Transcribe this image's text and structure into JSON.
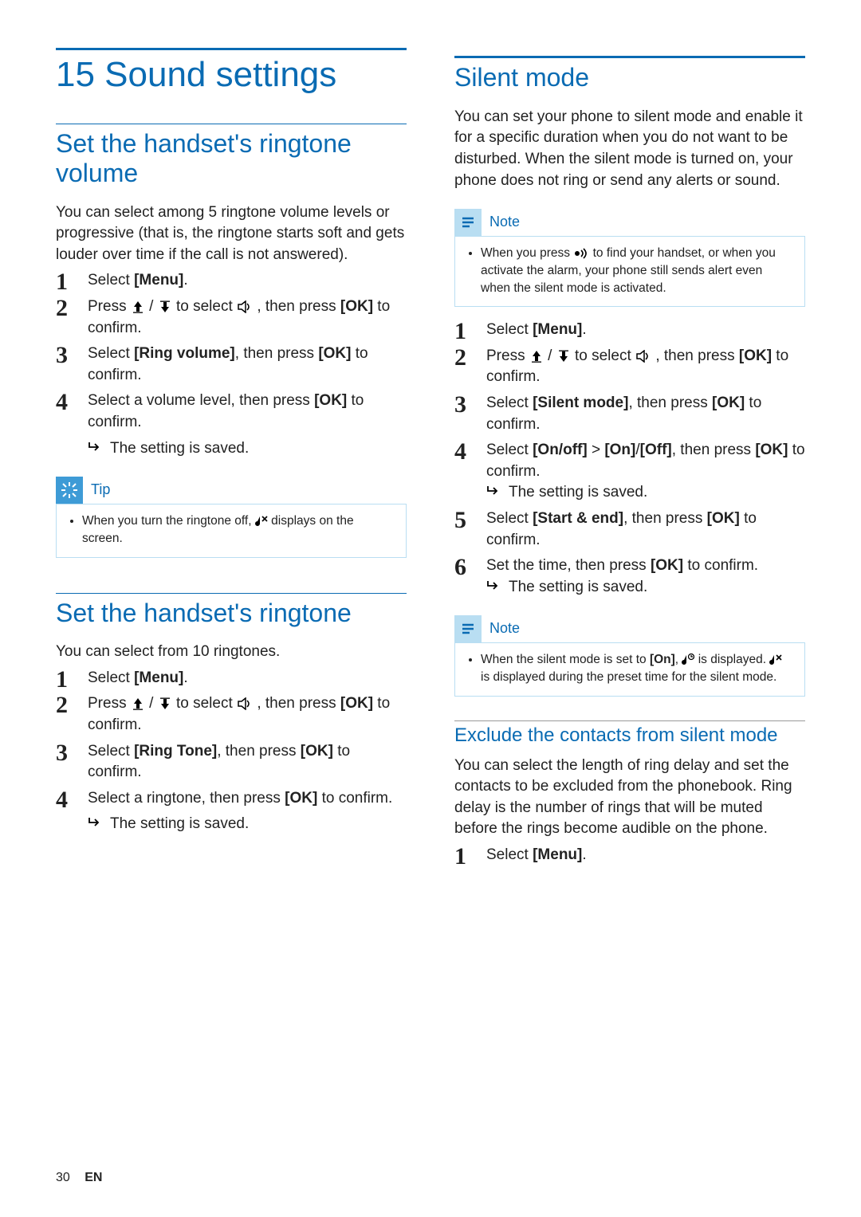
{
  "chapter": "15 Sound settings",
  "footer": {
    "pageNo": "30",
    "lang": "EN"
  },
  "icons": {
    "up": "up-icon",
    "down": "down-icon",
    "sound": "sound-icon",
    "pager": "pager-icon",
    "muteNote": "mute-note-icon",
    "clockNote": "clock-note-icon"
  },
  "callout_labels": {
    "tip": "Tip",
    "note": "Note"
  },
  "left": {
    "sec1": {
      "title": "Set the handset's ringtone volume",
      "intro": "You can select among 5 ringtone volume levels or progressive (that is, the ringtone starts soft and gets louder over time if the call is not answered).",
      "s1a": "Select ",
      "s1b": "[Menu]",
      "s1c": ".",
      "s2a": "Press ",
      "s2b": " / ",
      "s2c": " to select ",
      "s2d": ", then press ",
      "s2e": "[OK]",
      "s2f": " to confirm.",
      "s3a": "Select ",
      "s3b": "[Ring volume]",
      "s3c": ", then press ",
      "s3d": "[OK]",
      "s3e": " to confirm.",
      "s4a": "Select a volume level, then press ",
      "s4b": "[OK]",
      "s4c": " to confirm.",
      "result": "The setting is saved.",
      "tip_a": "When you turn the ringtone off, ",
      "tip_b": " displays on the screen."
    },
    "sec2": {
      "title": "Set the handset's ringtone",
      "intro": "You can select from 10 ringtones.",
      "s1a": "Select ",
      "s1b": "[Menu]",
      "s1c": ".",
      "s2a": "Press ",
      "s2b": " / ",
      "s2c": " to select ",
      "s2d": ", then press ",
      "s2e": "[OK]",
      "s2f": " to confirm.",
      "s3a": "Select ",
      "s3b": "[Ring Tone]",
      "s3c": ", then press ",
      "s3d": "[OK]",
      "s3e": " to confirm.",
      "s4a": "Select a ringtone, then press ",
      "s4b": "[OK]",
      "s4c": " to confirm.",
      "result": "The setting is saved."
    }
  },
  "right": {
    "sec1": {
      "title": "Silent mode",
      "intro": "You can set your phone to silent mode and enable it for a specific duration when you do not want to be disturbed. When the silent mode is turned on, your phone does not ring or send any alerts or sound.",
      "note1_a": "When you press ",
      "note1_b": " to find your handset, or when you activate the alarm, your phone still sends alert even when the silent mode is activated.",
      "s1a": "Select ",
      "s1b": "[Menu]",
      "s1c": ".",
      "s2a": "Press ",
      "s2b": " / ",
      "s2c": " to select ",
      "s2d": ", then press ",
      "s2e": "[OK]",
      "s2f": " to confirm.",
      "s3a": "Select ",
      "s3b": "[Silent mode]",
      "s3c": ", then press ",
      "s3d": "[OK]",
      "s3e": " to confirm.",
      "s4a": "Select ",
      "s4b": "[On/off]",
      "s4c": " > ",
      "s4d": "[On]",
      "s4e": "/",
      "s4f": "[Off]",
      "s4g": ", then press ",
      "s4h": "[OK]",
      "s4i": " to confirm.",
      "result1": "The setting is saved.",
      "s5a": "Select ",
      "s5b": "[Start & end]",
      "s5c": ", then press ",
      "s5d": "[OK]",
      "s5e": " to confirm.",
      "s6a": "Set the time, then press ",
      "s6b": "[OK]",
      "s6c": " to confirm.",
      "result2": "The setting is saved.",
      "note2_a": "When the silent mode is set to ",
      "note2_b": "[On]",
      "note2_c": ", ",
      "note2_d": " is displayed. ",
      "note2_e": " is displayed during the preset time for the silent mode."
    },
    "sec2": {
      "title": "Exclude the contacts from silent mode",
      "intro": "You can select the length of ring delay and set the contacts to be excluded from the phonebook. Ring delay is the number of rings that will be muted before the rings become audible on the phone.",
      "s1a": "Select ",
      "s1b": "[Menu]",
      "s1c": "."
    }
  }
}
